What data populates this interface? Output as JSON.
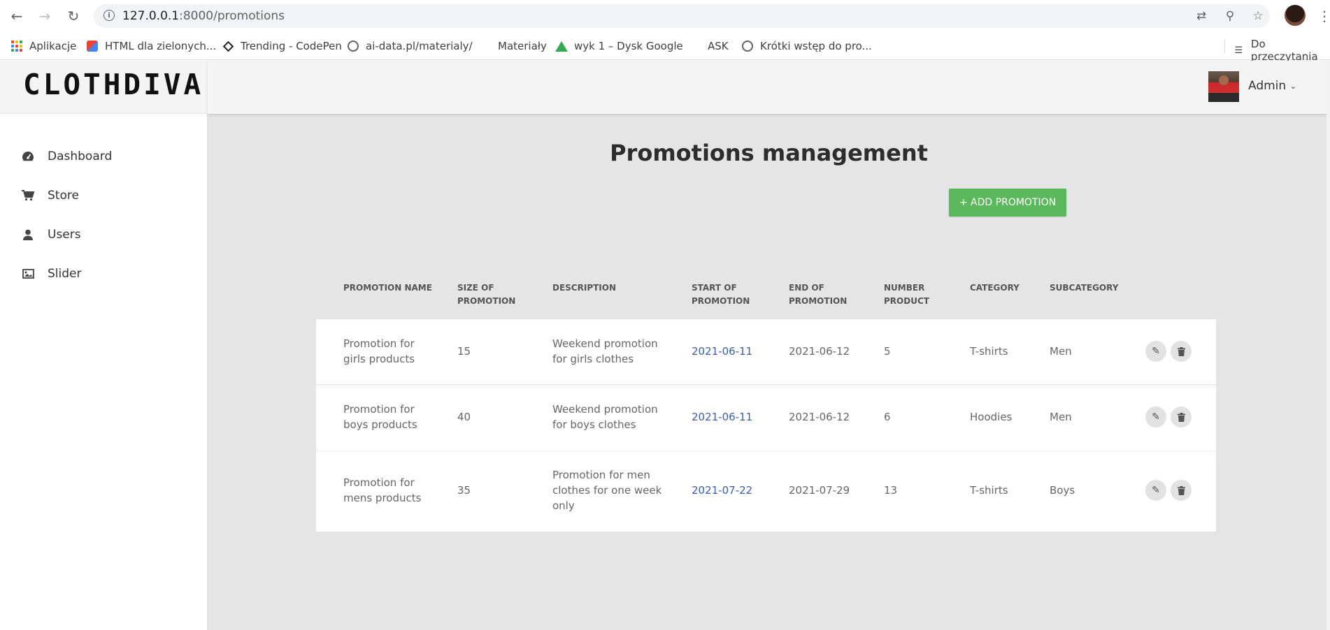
{
  "browser": {
    "url_host": "127.0.0.1",
    "url_rest": ":8000/promotions",
    "bookmarks": [
      {
        "label": "Aplikacje",
        "icon": "apps-icon"
      },
      {
        "label": "HTML dla zielonych...",
        "icon": "html-bookmark-icon"
      },
      {
        "label": "Trending - CodePen",
        "icon": "codepen-icon"
      },
      {
        "label": "ai-data.pl/materialy/",
        "icon": "globe-icon"
      },
      {
        "label": "Materiały",
        "icon": "none"
      },
      {
        "label": "wyk 1 – Dysk Google",
        "icon": "google-drive-icon"
      },
      {
        "label": "ASK",
        "icon": "none"
      },
      {
        "label": "Krótki wstęp do pro...",
        "icon": "globe-icon"
      }
    ],
    "reading_list": "Do przeczytania"
  },
  "app": {
    "logo": "CLOTHDIVA",
    "admin_name": "Admin",
    "sidebar": [
      {
        "label": "Dashboard",
        "icon": "dashboard-icon"
      },
      {
        "label": "Store",
        "icon": "cart-icon"
      },
      {
        "label": "Users",
        "icon": "user-icon"
      },
      {
        "label": "Slider",
        "icon": "image-icon"
      }
    ],
    "page_title": "Promotions management",
    "add_button": "+ ADD PROMOTION",
    "table": {
      "headers": [
        [
          "PROMOTION NAME",
          ""
        ],
        [
          "SIZE OF",
          "PROMOTION"
        ],
        [
          "DESCRIPTION",
          ""
        ],
        [
          "START OF",
          "PROMOTION"
        ],
        [
          "END OF",
          "PROMOTION"
        ],
        [
          "NUMBER",
          "PRODUCT"
        ],
        [
          "CATEGORY",
          ""
        ],
        [
          "SUBCATEGORY",
          ""
        ]
      ],
      "rows": [
        {
          "name": [
            "Promotion for",
            "girls products"
          ],
          "size": "15",
          "description": [
            "Weekend promotion",
            "for girls clothes"
          ],
          "start": "2021-06-11",
          "end": "2021-06-12",
          "number": "5",
          "category": "T-shirts",
          "subcategory": "Men"
        },
        {
          "name": [
            "Promotion for",
            "boys products"
          ],
          "size": "40",
          "description": [
            "Weekend promotion",
            "for boys clothes"
          ],
          "start": "2021-06-11",
          "end": "2021-06-12",
          "number": "6",
          "category": "Hoodies",
          "subcategory": "Men"
        },
        {
          "name": [
            "Promotion for",
            "mens products"
          ],
          "size": "35",
          "description": [
            "Promotion for men",
            "clothes for one week",
            "only"
          ],
          "start": "2021-07-22",
          "end": "2021-07-29",
          "number": "13",
          "category": "T-shirts",
          "subcategory": "Boys"
        }
      ]
    }
  },
  "colors": {
    "accent_green": "#5cb85c",
    "link_blue": "#3b5fa8",
    "main_bg": "#e5e5e5"
  }
}
